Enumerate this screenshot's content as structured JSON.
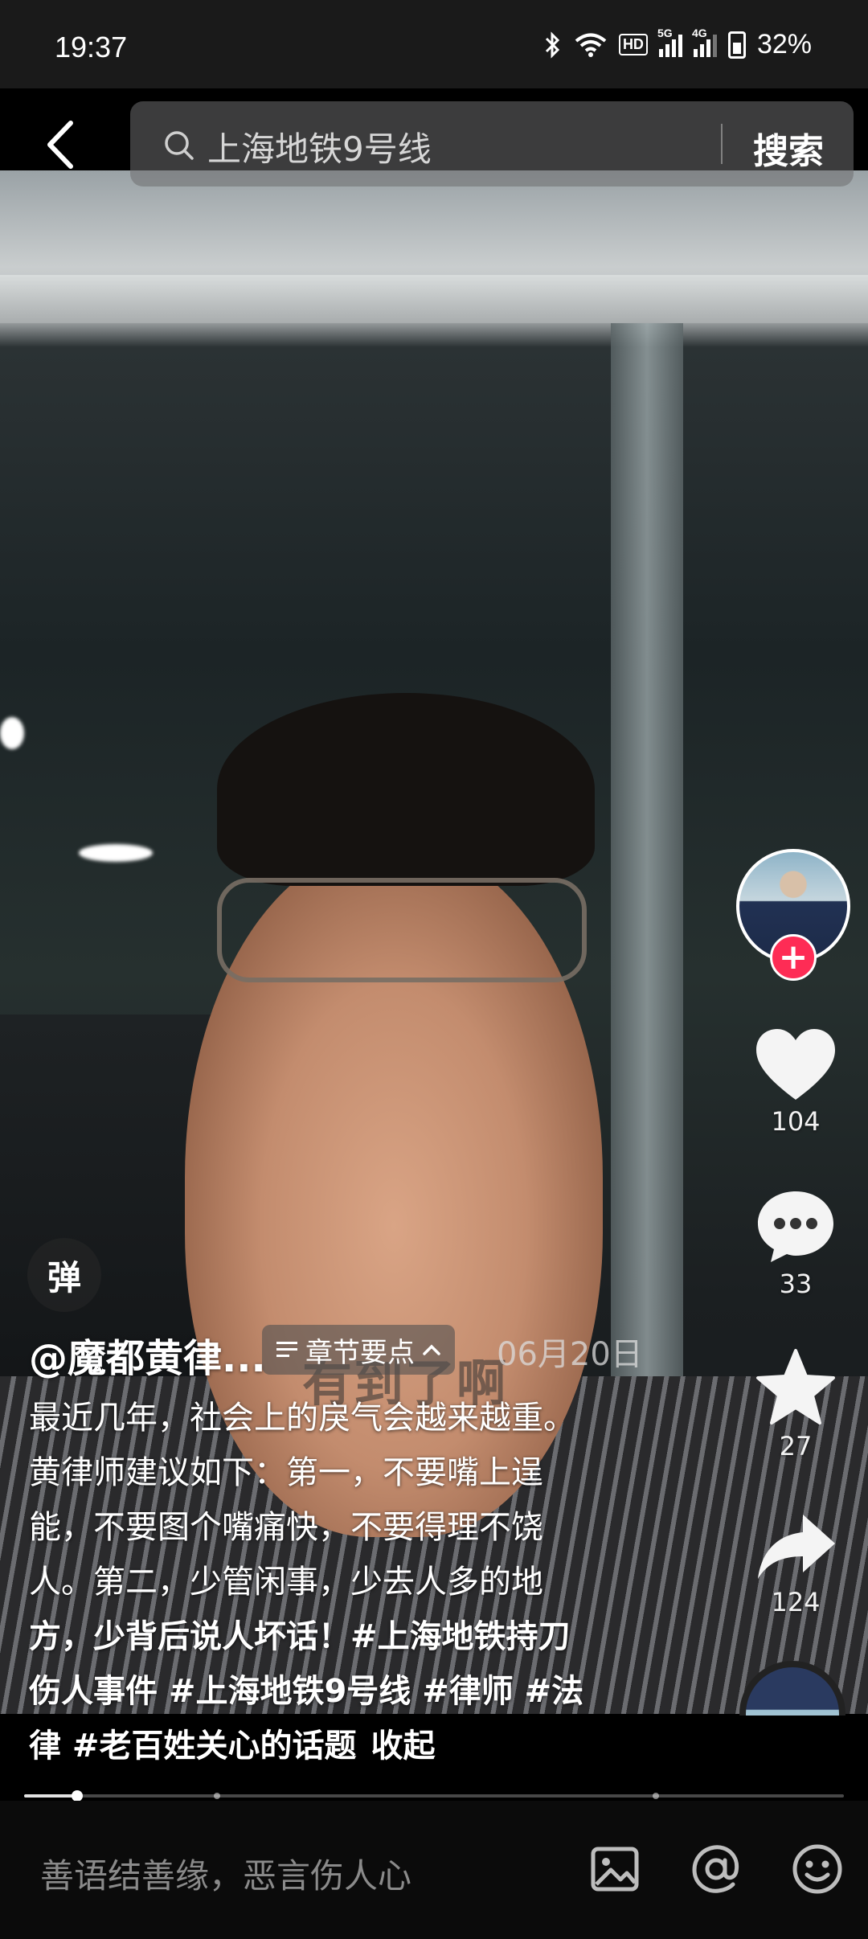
{
  "status_bar": {
    "time": "19:37",
    "hd_label": "HD",
    "net1": "5G",
    "net2": "4G",
    "battery": "32%"
  },
  "search": {
    "query": "上海地铁9号线",
    "button_label": "搜索"
  },
  "rail": {
    "likes": "104",
    "comments": "33",
    "favorites": "27",
    "shares": "124"
  },
  "danmaku_label": "弹",
  "post": {
    "author": "@魔都黄律...",
    "chapter_label": "章节要点",
    "date": "06月20日",
    "subtitle_overlay": "有到了啊",
    "description_lines": [
      "最近几年，社会上的戾气会越来越重。",
      "黄律师建议如下：第一，不要嘴上逞",
      "能，不要图个嘴痛快，不要得理不饶",
      "人。第二，少管闲事，少去人多的地",
      "方，少背后说人坏话！#上海地铁持刀",
      "伤人事件 #上海地铁9号线 #律师 #法"
    ],
    "description_last_line": "律 #老百姓关心的话题",
    "collapse_label": "收起"
  },
  "progress": {
    "played_fraction": 0.065
  },
  "comment_bar": {
    "placeholder": "善语结善缘，恶言伤人心"
  },
  "icons": {
    "back": "back-arrow-icon",
    "search": "search-icon",
    "like": "heart-icon",
    "comment": "comment-icon",
    "favorite": "star-icon",
    "share": "share-icon",
    "image": "image-icon",
    "mention": "at-icon",
    "emoji": "emoji-icon"
  },
  "colors": {
    "follow": "#fe2c55",
    "background": "#000000"
  }
}
